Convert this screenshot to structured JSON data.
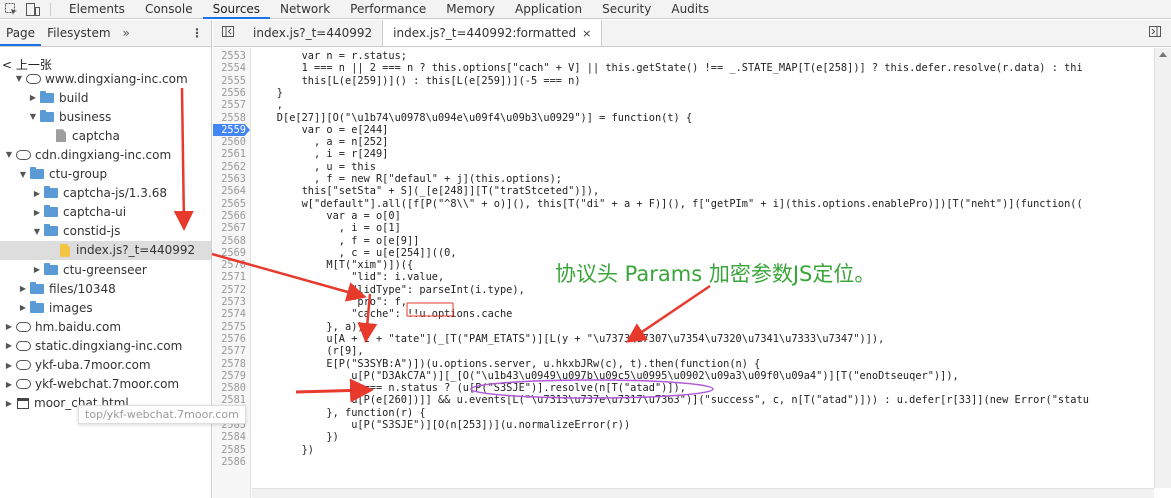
{
  "topbar": {
    "tabs": [
      "Elements",
      "Console",
      "Sources",
      "Network",
      "Performance",
      "Memory",
      "Application",
      "Security",
      "Audits"
    ],
    "active_tab": "Sources"
  },
  "navigator": {
    "tabs": [
      "Page",
      "Filesystem"
    ],
    "more": "»",
    "kebab": "⋮",
    "back_link": "< 上一张",
    "tree": [
      {
        "label": "www.dingxiang-inc.com",
        "type": "cloud",
        "open": true
      },
      {
        "label": "build",
        "type": "folder",
        "open": false
      },
      {
        "label": "business",
        "type": "folder",
        "open": true
      },
      {
        "label": "captcha",
        "type": "file"
      },
      {
        "label": "cdn.dingxiang-inc.com",
        "type": "cloud",
        "open": true
      },
      {
        "label": "ctu-group",
        "type": "folder",
        "open": true
      },
      {
        "label": "captcha-js/1.3.68",
        "type": "folder",
        "open": false
      },
      {
        "label": "captcha-ui",
        "type": "folder",
        "open": false
      },
      {
        "label": "constid-js",
        "type": "folder",
        "open": true
      },
      {
        "label": "index.js?_t=440992",
        "type": "js"
      },
      {
        "label": "ctu-greenseer",
        "type": "folder",
        "open": false
      },
      {
        "label": "files/10348",
        "type": "folder",
        "open": false
      },
      {
        "label": "images",
        "type": "folder",
        "open": false
      },
      {
        "label": "hm.baidu.com",
        "type": "cloud",
        "open": false
      },
      {
        "label": "static.dingxiang-inc.com",
        "type": "cloud",
        "open": false
      },
      {
        "label": "ykf-uba.7moor.com",
        "type": "cloud",
        "open": false
      },
      {
        "label": "ykf-webchat.7moor.com",
        "type": "cloud",
        "open": false
      },
      {
        "label": "moor_chat.html",
        "type": "frame",
        "open": false
      }
    ],
    "tooltip": "top/ykf-webchat.7moor.com"
  },
  "editor": {
    "tabs": [
      "index.js?_t=440992",
      "index.js?_t=440992:formatted"
    ],
    "active_tab": "index.js?_t=440992:formatted",
    "close": "×",
    "breakpoint_line": "2559",
    "lines": [
      {
        "n": "2553",
        "t": "        var n = r.status;"
      },
      {
        "n": "2554",
        "t": "        1 === n || 2 === n ? this.options[\"cach\" + V] || this.getState() !== _.STATE_MAP[T(e[258])] ? this.defer.resolve(r.data) : thi"
      },
      {
        "n": "2555",
        "t": "        this[L(e[259])]() : this[L(e[259])](-5 === n)"
      },
      {
        "n": "2556",
        "t": "    }"
      },
      {
        "n": "2557",
        "t": "    ,"
      },
      {
        "n": "2558",
        "t": "    D[e[27]][O(\"\\u1b74\\u0978\\u094e\\u09f4\\u09b3\\u0929\")] = function(t) {"
      },
      {
        "n": "2559",
        "t": "        var o = e[244]"
      },
      {
        "n": "2560",
        "t": "          , a = n[252]"
      },
      {
        "n": "2561",
        "t": "          , i = r[249]"
      },
      {
        "n": "2562",
        "t": "          , u = this"
      },
      {
        "n": "2563",
        "t": "          , f = new R[\"defaul\" + j](this.options);"
      },
      {
        "n": "2564",
        "t": "        this[\"setSta\" + S](_[e[248]][T(\"tratStceted\")]),"
      },
      {
        "n": "2565",
        "t": "        w[\"default\"].all([f[P(\"^8\\\\\" + o)](), this[T(\"di\" + a + F)](), f[\"getPIm\" + i](this.options.enablePro)])[T(\"neht\")](function(("
      },
      {
        "n": "2566",
        "t": "            var a = o[0]"
      },
      {
        "n": "2567",
        "t": "              , i = o[1]"
      },
      {
        "n": "2568",
        "t": "              , f = o[e[9]]"
      },
      {
        "n": "2569",
        "t": "              , c = u[e[254]]((0,"
      },
      {
        "n": "2570",
        "t": "            M[T(\"xim\")])({"
      },
      {
        "n": "2571",
        "t": "                \"lid\": i.value,"
      },
      {
        "n": "2572",
        "t": "                \"lidType\": parseInt(i.type),"
      },
      {
        "n": "2573",
        "t": "                \"pro\": f,"
      },
      {
        "n": "2574",
        "t": "                \"cache\": !!u.options.cache"
      },
      {
        "n": "2575",
        "t": "            }, a));"
      },
      {
        "n": "2576",
        "t": "            u[A + I + \"tate\"](_[T(\"PAM_ETATS\")][L(y + \"\\u7373\\u7307\\u7354\\u7320\\u7341\\u7333\\u7347\")]),"
      },
      {
        "n": "2577",
        "t": "            (r[9],"
      },
      {
        "n": "2578",
        "t": "            E[P(\"S3SYB:A\")])(u.options.server, u.hkxbJRw(c), t).then(function(n) {"
      },
      {
        "n": "2579",
        "t": "                u[P(\"D3AkC7A\")][_[O(\"\\u1b43\\u0949\\u097b\\u09c5\\u0995\\u0902\\u09a3\\u09f0\\u09a4\")][T(\"enoDtseuqer\")]),"
      },
      {
        "n": "2580",
        "t": "                2 === n.status ? (u[P(\"S3SJE\")].resolve(n[T(\"atad\")]),"
      },
      {
        "n": "2581",
        "t": "                u[P(e[260])]] && u.events[L(\"\\u7313\\u737e\\u7317\\u7363\")](\"success\", c, n[T(\"atad\")])) : u.defer[r[33]](new Error(\"statu"
      },
      {
        "n": "2582",
        "t": "            }, function(r) {"
      },
      {
        "n": "2583",
        "t": "                u[P(\"S3SJE\")][O(n[253])](u.normalizeError(r))"
      },
      {
        "n": "2584",
        "t": "            })"
      },
      {
        "n": "2585",
        "t": "        })"
      },
      {
        "n": "2586",
        "t": ""
      }
    ]
  },
  "annotation": {
    "text": "协议头  Params  加密参数JS定位。",
    "color": "#3aa53a",
    "arrow_color": "#e8392d"
  },
  "colors": {
    "accent": "#1a73e8",
    "folder": "#5a9bd6",
    "breakpoint": "#4285f4",
    "js_file": "#f4c542"
  }
}
